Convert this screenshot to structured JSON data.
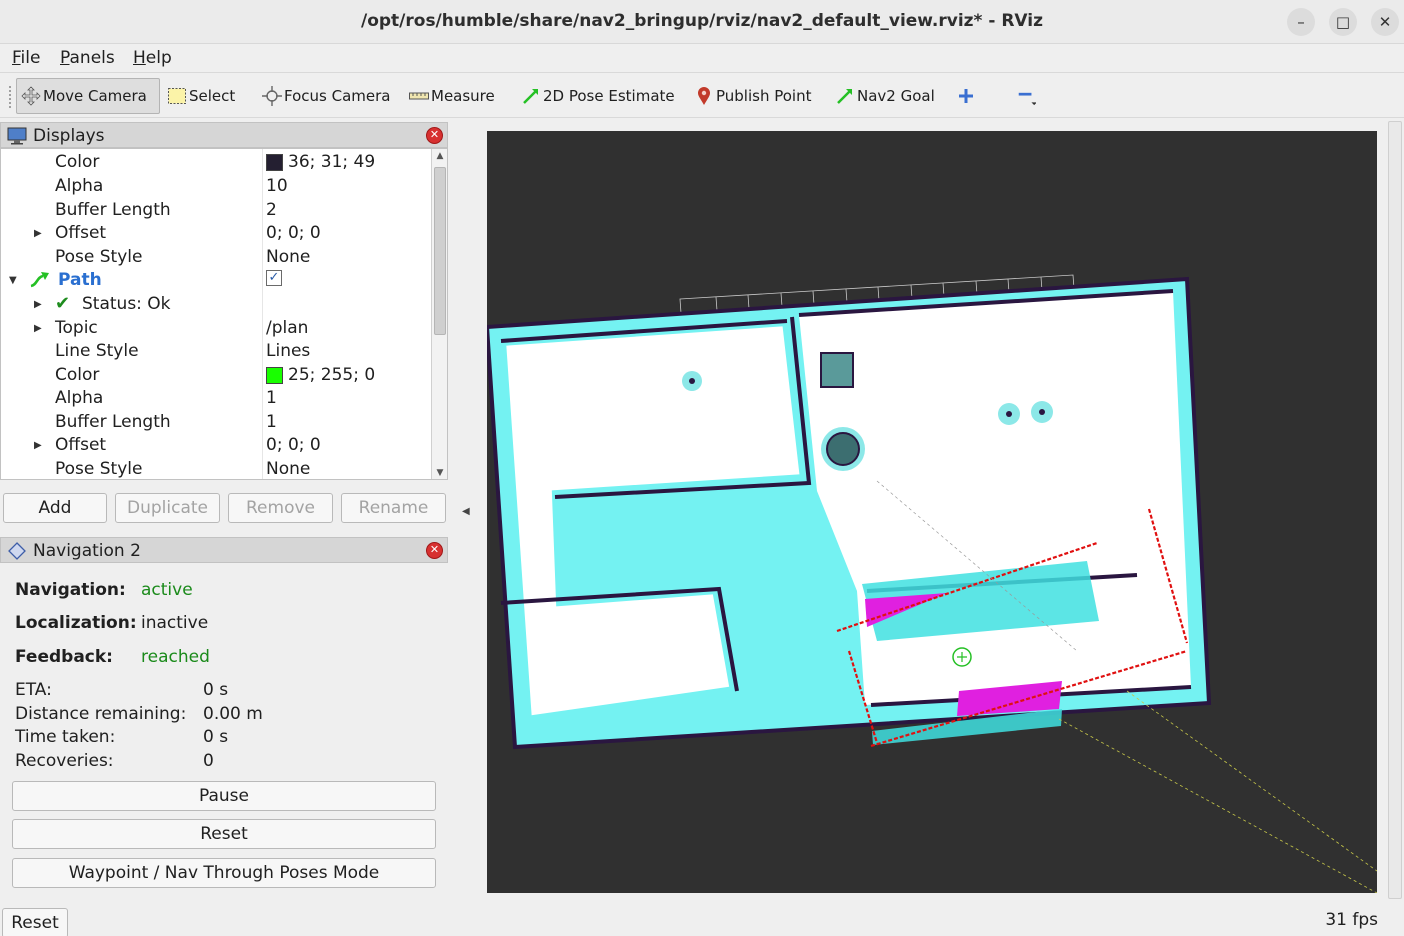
{
  "window": {
    "title": "/opt/ros/humble/share/nav2_bringup/rviz/nav2_default_view.rviz* - RViz",
    "minimize_label": "–",
    "maximize_label": "□",
    "close_label": "✕"
  },
  "menu": {
    "file": {
      "first": "F",
      "rest": "ile"
    },
    "panels": {
      "first": "P",
      "rest": "anels"
    },
    "help": {
      "first": "H",
      "rest": "elp"
    }
  },
  "toolbar": {
    "move_camera": "Move Camera",
    "select": "Select",
    "focus_camera": "Focus Camera",
    "measure": "Measure",
    "pose_estimate": "2D Pose Estimate",
    "publish_point": "Publish Point",
    "nav2_goal": "Nav2 Goal"
  },
  "displays": {
    "title": "Displays",
    "rows": [
      {
        "key": "Color",
        "value": "36; 31; 49",
        "swatch": "#241f31"
      },
      {
        "key": "Alpha",
        "value": "10"
      },
      {
        "key": "Buffer Length",
        "value": "2"
      },
      {
        "key": "Offset",
        "value": "0; 0; 0"
      },
      {
        "key": "Pose Style",
        "value": "None"
      },
      {
        "key": "Path",
        "value": "✓"
      },
      {
        "key": "Status: Ok",
        "value": ""
      },
      {
        "key": "Topic",
        "value": "/plan"
      },
      {
        "key": "Line Style",
        "value": "Lines"
      },
      {
        "key": "Color",
        "value": "25; 255; 0",
        "swatch": "#19ff00"
      },
      {
        "key": "Alpha",
        "value": "1"
      },
      {
        "key": "Buffer Length",
        "value": "1"
      },
      {
        "key": "Offset",
        "value": "0; 0; 0"
      },
      {
        "key": "Pose Style",
        "value": "None"
      }
    ],
    "buttons": {
      "add": "Add",
      "duplicate": "Duplicate",
      "remove": "Remove",
      "rename": "Rename"
    }
  },
  "navigation": {
    "title": "Navigation 2",
    "navigation_label": "Navigation:",
    "navigation_value": "active",
    "localization_label": "Localization:",
    "localization_value": "inactive",
    "feedback_label": "Feedback:",
    "feedback_value": "reached",
    "eta_label": "ETA:",
    "eta_value": "0 s",
    "distance_label": "Distance remaining:",
    "distance_value": "0.00 m",
    "time_label": "Time taken:",
    "time_value": "0 s",
    "recoveries_label": "Recoveries:",
    "recoveries_value": "0",
    "pause": "Pause",
    "reset": "Reset",
    "mode": "Waypoint / Nav Through Poses Mode"
  },
  "status": {
    "reset": "Reset",
    "fps": "31 fps"
  },
  "colors": {
    "viewport_bg": "#303030",
    "map_free": "#ffffff",
    "costmap_inflation": "#74f2f2",
    "wall": "#2a1640",
    "path": "#19ff00",
    "scan": "#e01010",
    "active_green": "#1a8a1a"
  }
}
